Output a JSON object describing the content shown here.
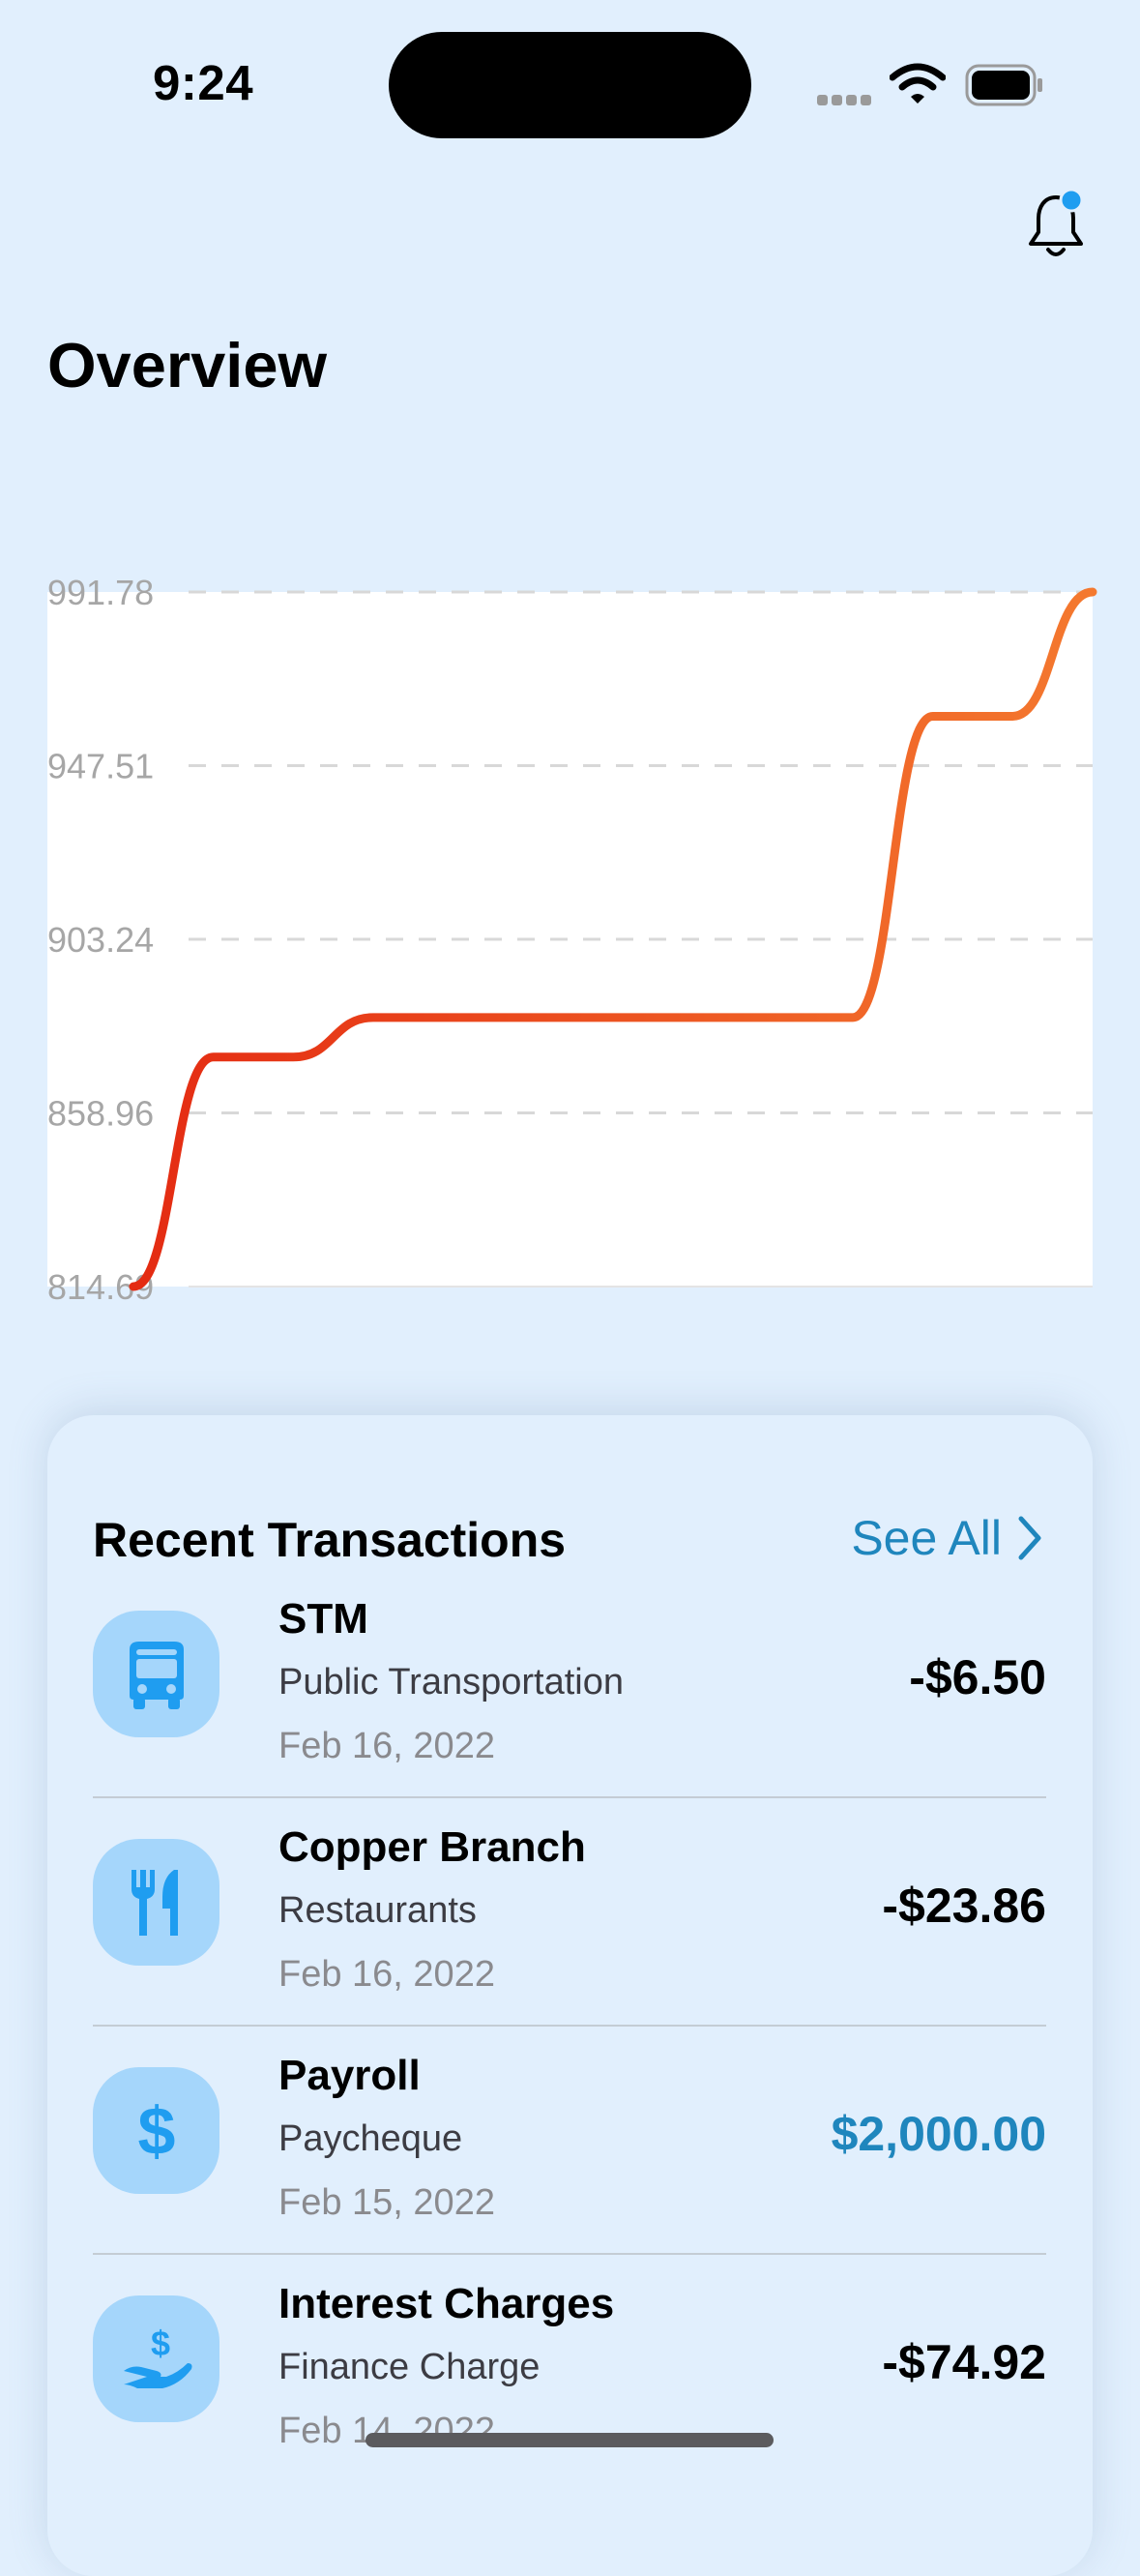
{
  "status_bar": {
    "time": "9:24"
  },
  "header": {
    "title": "Overview"
  },
  "chart_data": {
    "type": "line",
    "y_ticks": [
      "991.78",
      "947.51",
      "903.24",
      "858.96",
      "814.69"
    ],
    "ylim": [
      814.69,
      991.78
    ],
    "grid": true,
    "series": [
      {
        "values": [
          814.69,
          873.2,
          873.2,
          883.3,
          883.3,
          883.3,
          883.3,
          883.3,
          883.3,
          883.3,
          960.1,
          960.1,
          991.78
        ]
      }
    ],
    "colors": {
      "start": "#e42b12",
      "end": "#f4792f"
    }
  },
  "transactions_card": {
    "title": "Recent Transactions",
    "see_all_label": "See All",
    "items": [
      {
        "icon": "bus-icon",
        "name": "STM",
        "category": "Public Transportation",
        "date": "Feb 16, 2022",
        "amount": "-$6.50",
        "positive": false
      },
      {
        "icon": "fork-knife-icon",
        "name": "Copper Branch",
        "category": "Restaurants",
        "date": "Feb 16, 2022",
        "amount": "-$23.86",
        "positive": false
      },
      {
        "icon": "dollar-icon",
        "name": "Payroll",
        "category": "Paycheque",
        "date": "Feb 15, 2022",
        "amount": "$2,000.00",
        "positive": true
      },
      {
        "icon": "hand-dollar-icon",
        "name": "Interest Charges",
        "category": "Finance Charge",
        "date": "Feb 14, 2022",
        "amount": "-$74.92",
        "positive": false
      }
    ]
  },
  "colors": {
    "background": "#e1effd",
    "accent": "#1f86bd",
    "icon_bg": "#a5d6fb",
    "icon_fg": "#1f9df0"
  }
}
